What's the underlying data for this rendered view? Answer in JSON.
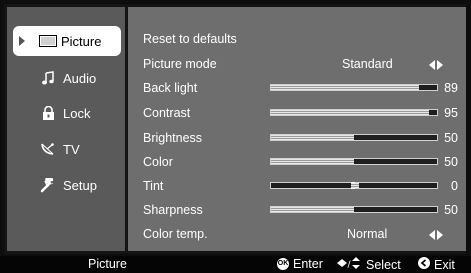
{
  "sidebar": {
    "items": [
      {
        "label": "Picture",
        "icon": "picture-icon",
        "selected": true
      },
      {
        "label": "Audio",
        "icon": "music-note-icon",
        "selected": false
      },
      {
        "label": "Lock",
        "icon": "lock-icon",
        "selected": false
      },
      {
        "label": "TV",
        "icon": "satellite-dish-icon",
        "selected": false
      },
      {
        "label": "Setup",
        "icon": "wrench-icon",
        "selected": false
      }
    ]
  },
  "menu": {
    "reset": "Reset to defaults",
    "picture_mode": {
      "label": "Picture mode",
      "value": "Standard"
    },
    "back_light": {
      "label": "Back light",
      "value": "89",
      "level": 89
    },
    "contrast": {
      "label": "Contrast",
      "value": "95",
      "level": 95
    },
    "brightness": {
      "label": "Brightness",
      "value": "50",
      "level": 50
    },
    "color": {
      "label": "Color",
      "value": "50",
      "level": 50
    },
    "tint": {
      "label": "Tint",
      "value": "0",
      "level": 0
    },
    "sharpness": {
      "label": "Sharpness",
      "value": "50",
      "level": 50
    },
    "color_temp": {
      "label": "Color temp.",
      "value": "Normal"
    }
  },
  "footer": {
    "title": "Picture",
    "enter_label": "Enter",
    "enter_icon_text": "OK",
    "select_label": "Select",
    "exit_label": "Exit"
  },
  "colors": {
    "sidebar_bg": "#5a5a5a",
    "main_bg": "#6e6e6e",
    "footer_bg": "#050505",
    "selected_bg": "#ffffff"
  }
}
